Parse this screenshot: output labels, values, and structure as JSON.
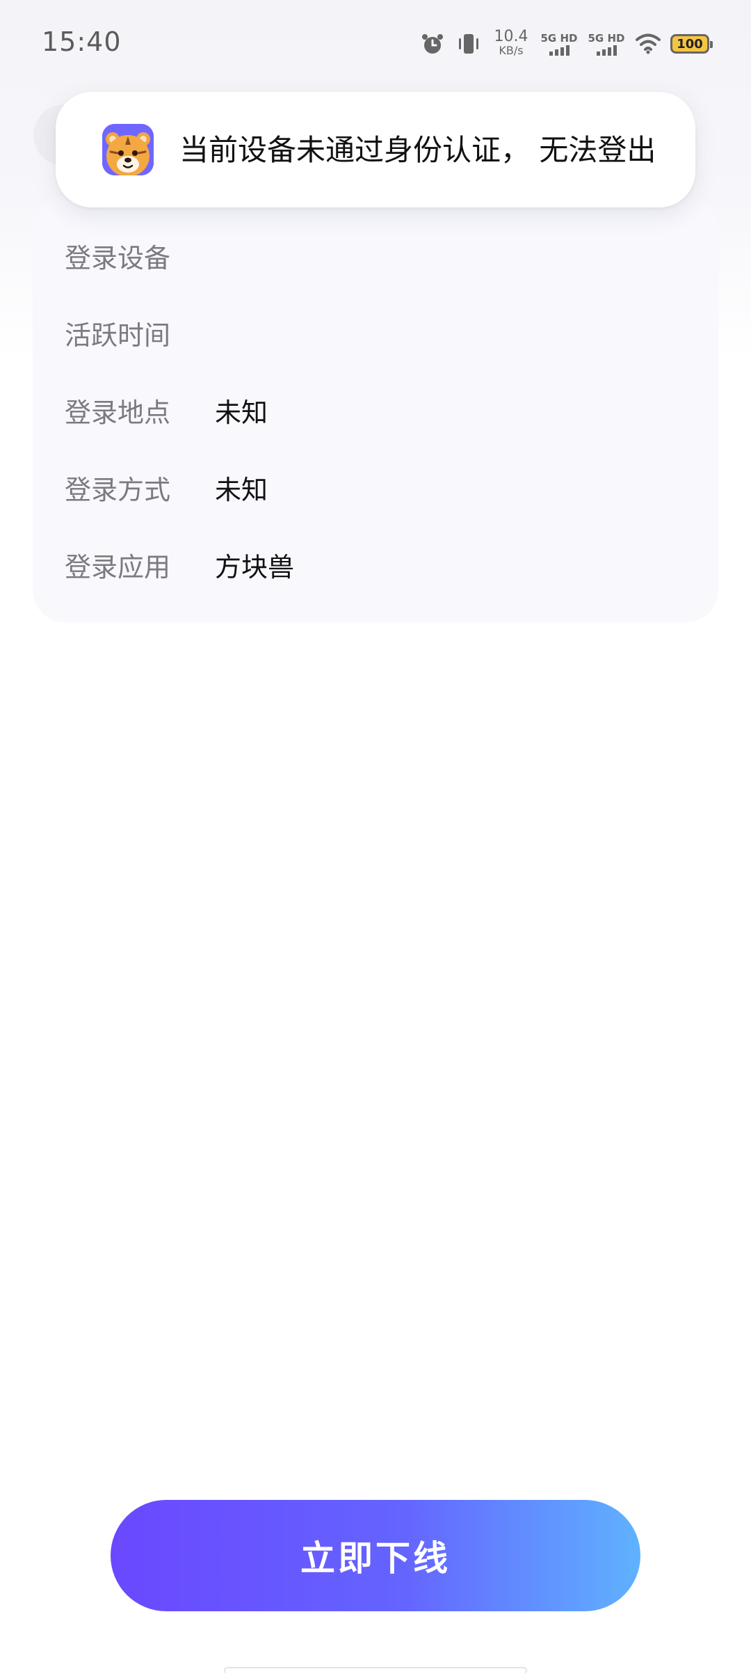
{
  "status_bar": {
    "time": "15:40",
    "net_speed_value": "10.4",
    "net_speed_unit": "KB/s",
    "sim1_label": "5G HD",
    "sim2_label": "5G HD",
    "battery": "100",
    "icons": [
      "alarm-icon",
      "vibrate-icon",
      "wifi-icon",
      "battery-icon"
    ]
  },
  "toast": {
    "app_icon": "tiger-app-icon",
    "message": "当前设备未通过身份认证， 无法登出"
  },
  "device_info": {
    "rows": [
      {
        "label": "登录设备",
        "value": ""
      },
      {
        "label": "活跃时间",
        "value": ""
      },
      {
        "label": "登录地点",
        "value": "未知"
      },
      {
        "label": "登录方式",
        "value": "未知"
      },
      {
        "label": "登录应用",
        "value": "方块兽"
      }
    ]
  },
  "actions": {
    "offline_label": "立即下线"
  },
  "colors": {
    "button_gradient_start": "#6a48ff",
    "button_gradient_end": "#5fb2ff",
    "card_background": "#f8f8fd",
    "battery_fill": "#f5c542"
  }
}
